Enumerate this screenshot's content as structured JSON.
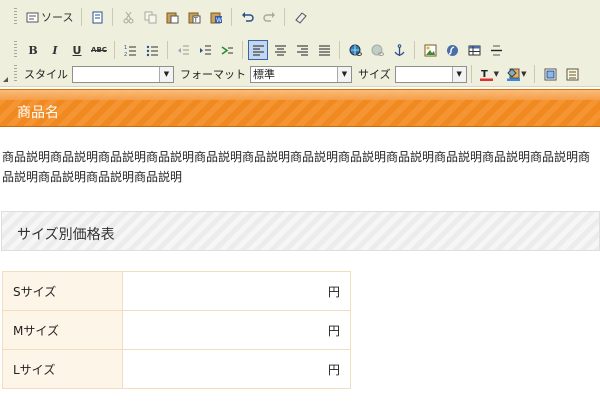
{
  "toolbar": {
    "source_label": "ソース",
    "style_label": "スタイル",
    "style_value": "",
    "format_label": "フォーマット",
    "format_value": "標準",
    "size_label": "サイズ",
    "size_value": "",
    "bold": "B",
    "italic": "I",
    "underline": "U",
    "strike": "ABC"
  },
  "product": {
    "title": "商品名",
    "description": "商品説明商品説明商品説明商品説明商品説明商品説明商品説明商品説明商品説明商品説明商品説明商品説明商品説明商品説明商品説明商品説明"
  },
  "price_section": {
    "heading": "サイズ別価格表",
    "rows": [
      {
        "size": "Sサイズ",
        "price": "円"
      },
      {
        "size": "Mサイズ",
        "price": "円"
      },
      {
        "size": "Lサイズ",
        "price": "円"
      }
    ]
  },
  "colors": {
    "accent": "#f08a20",
    "toolbar_bg": "#efefde",
    "table_border": "#f4dcbf"
  }
}
